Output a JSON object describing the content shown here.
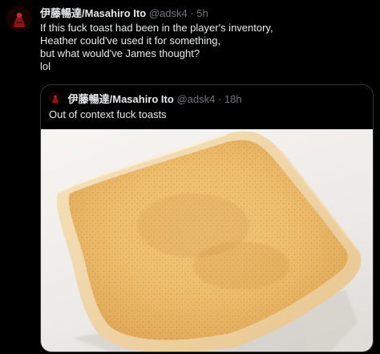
{
  "tweet": {
    "author_name": "伊藤暢達/Masahiro Ito",
    "author_handle": "@adsk4",
    "separator": "·",
    "time": "5h",
    "lines": [
      "If this fuck toast had been in the player's inventory,",
      "Heather could've used it for something,",
      "but what would've James thought?",
      "lol"
    ]
  },
  "quoted": {
    "author_name": "伊藤暢達/Masahiro Ito",
    "author_handle": "@adsk4",
    "separator": "·",
    "time": "18h",
    "text": "Out of context fuck toasts",
    "image_subject": "toast-slice"
  },
  "colors": {
    "background": "#000000",
    "text": "#e7e9ea",
    "secondary_text": "#71767b",
    "border": "#2f3336"
  }
}
